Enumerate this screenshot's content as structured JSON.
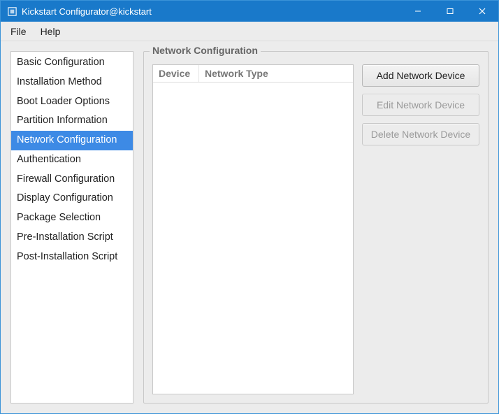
{
  "window": {
    "title": "Kickstart Configurator@kickstart"
  },
  "menu": {
    "file": "File",
    "help": "Help"
  },
  "sidebar": {
    "items": [
      {
        "label": "Basic Configuration"
      },
      {
        "label": "Installation Method"
      },
      {
        "label": "Boot Loader Options"
      },
      {
        "label": "Partition Information"
      },
      {
        "label": "Network Configuration"
      },
      {
        "label": "Authentication"
      },
      {
        "label": "Firewall Configuration"
      },
      {
        "label": "Display Configuration"
      },
      {
        "label": "Package Selection"
      },
      {
        "label": "Pre-Installation Script"
      },
      {
        "label": "Post-Installation Script"
      }
    ],
    "selected_index": 4
  },
  "main": {
    "group_title": "Network Configuration",
    "table": {
      "columns": {
        "device": "Device",
        "network_type": "Network Type"
      },
      "rows": []
    },
    "buttons": {
      "add": "Add Network Device",
      "edit": "Edit Network Device",
      "delete": "Delete Network Device"
    }
  }
}
